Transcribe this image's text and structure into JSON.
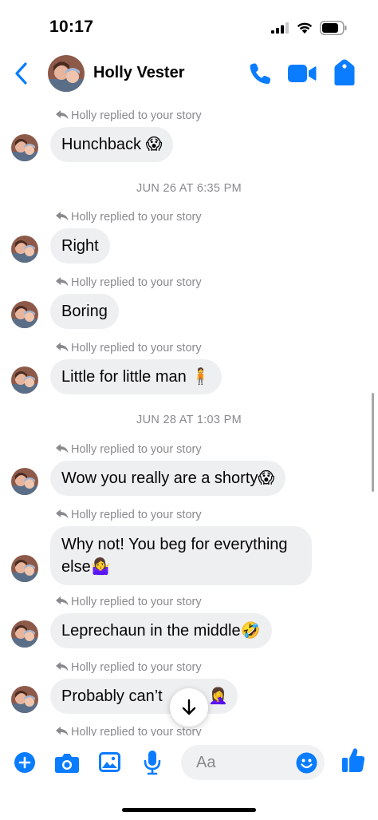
{
  "status_bar": {
    "time": "10:17",
    "icons": [
      "signal-icon",
      "wifi-icon",
      "battery-icon"
    ]
  },
  "header": {
    "contact_name": "Holly Vester",
    "icons": [
      "back-icon",
      "call-icon",
      "video-call-icon",
      "tag-icon"
    ]
  },
  "chat": {
    "date_separators": [
      "JUN 26 AT 6:35 PM",
      "JUN 28 AT 1:03 PM"
    ],
    "messages": [
      {
        "reply_note": "Holly replied to your story",
        "text": "Hunchback",
        "emoji": "😱"
      },
      {
        "reply_note": "Holly replied to your story",
        "text": "Right",
        "emoji": ""
      },
      {
        "reply_note": "Holly replied to your story",
        "text": "Boring",
        "emoji": ""
      },
      {
        "reply_note": "Holly replied to your story",
        "text": "Little for little man",
        "emoji": "🧍"
      },
      {
        "reply_note": "Holly replied to your story",
        "text": "Wow you really are a shorty",
        "emoji": "😱"
      },
      {
        "reply_note": "Holly replied to your story",
        "text": "Why not! You beg for everything else",
        "emoji": "🤷‍♀️"
      },
      {
        "reply_note": "Holly replied to your story",
        "text": "Leprechaun in the middle",
        "emoji": "🤣"
      },
      {
        "reply_note": "Holly replied to your story",
        "text": "Probably can’t",
        "emoji": "🤦‍♀️"
      },
      {
        "reply_note": "Holly replied to your story",
        "text": "",
        "emoji": ""
      }
    ]
  },
  "scroll_down_icon": "arrow-down-icon",
  "composer": {
    "placeholder": "Aa",
    "icons": [
      "plus-icon",
      "camera-icon",
      "photo-icon",
      "microphone-icon",
      "emoji-icon",
      "thumbs-up-icon"
    ]
  },
  "colors": {
    "accent": "#0a7cff",
    "bubble": "#eeeff1",
    "meta_text": "#8a8a8e"
  }
}
